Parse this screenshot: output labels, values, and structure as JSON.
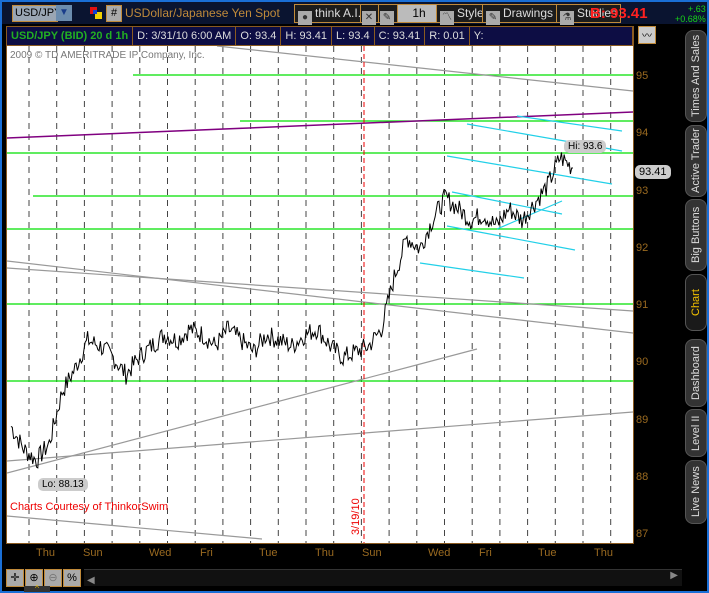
{
  "toolbar": {
    "symbol": "USD/JPY",
    "description": "USDollar/Japanese Yen Spot",
    "think_ai": "think A.I.",
    "interval": "1h",
    "style": "Style",
    "drawings": "Drawings",
    "studies": "Studies",
    "bid": "B: 93.41",
    "change": "+.63",
    "change_pct": "+0.68%"
  },
  "info": {
    "title": "USD/JPY (BID) 20 d 1h",
    "date": "D: 3/31/10 6:00 AM",
    "open": "O: 93.4",
    "high": "H: 93.41",
    "low": "L: 93.4",
    "close": "C: 93.41",
    "range": "R: 0.01",
    "y": "Y:"
  },
  "chart": {
    "copyright": "2009 © TD AMERITRADE IP Company, Inc.",
    "courtesy": "Charts Courtesy of ThinkorSwim",
    "marker_date": "3/19/10",
    "hi_label": "Hi: 93.6",
    "lo_label": "Lo: 88.13",
    "last_price": "93.41"
  },
  "chart_data": {
    "type": "line",
    "title": "USD/JPY (BID) 20 d 1h",
    "ylim": [
      87,
      95.5
    ],
    "y_ticks": [
      "95",
      "94",
      "93",
      "92",
      "91",
      "90",
      "89",
      "88",
      "87"
    ],
    "x_ticks": [
      "Thu",
      "Sun",
      "Wed",
      "Fri",
      "Tue",
      "Thu",
      "Sun",
      "Wed",
      "Fri",
      "Tue",
      "Thu"
    ],
    "values": [
      88.9,
      88.5,
      88.3,
      88.6,
      89.5,
      89.9,
      90.4,
      90.3,
      90.1,
      89.8,
      90.1,
      90.3,
      90.5,
      90.4,
      90.6,
      90.5,
      90.3,
      90.6,
      90.4,
      90.2,
      90.5,
      90.4,
      90.3,
      90.5,
      90.6,
      90.3,
      90.1,
      90.2,
      90.3,
      90.6,
      91.5,
      92.2,
      92.0,
      92.5,
      92.9,
      92.7,
      92.5,
      92.6,
      92.4,
      92.7,
      92.5,
      92.8,
      93.1,
      93.6,
      93.41
    ],
    "hi": 93.6,
    "lo": 88.13,
    "last": 93.41
  },
  "tabs": [
    "Times And Sales",
    "Active Trader",
    "Big Buttons",
    "Chart",
    "Dashboard",
    "Level II",
    "Live News"
  ],
  "bottom": {
    "percent": "%"
  }
}
